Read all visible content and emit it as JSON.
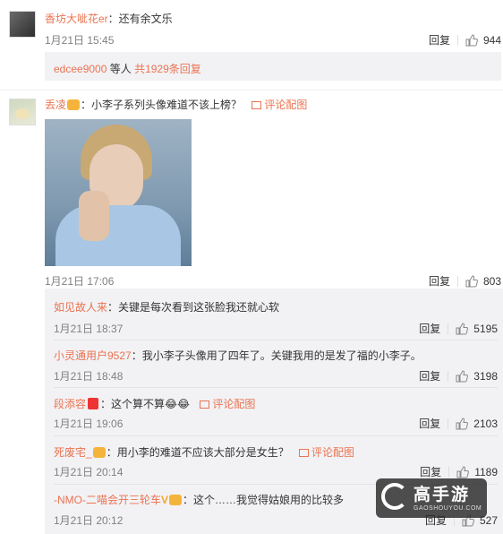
{
  "comments": [
    {
      "user": "香坊大呲花er",
      "text": "：还有余文乐",
      "time": "1月21日 15:45",
      "reply": "回复",
      "likes": "944"
    },
    {
      "user": "丢凌",
      "text": "：小李子系列头像难道不该上榜？",
      "pic_link": "评论配图",
      "time": "1月21日 17:06",
      "reply": "回复",
      "likes": "803"
    }
  ],
  "more_replies": {
    "user": "edcee9000",
    "middle": " 等人 ",
    "count": "共1929条回复"
  },
  "sub_replies": [
    {
      "user": "如见故人来",
      "text": "：关键是每次看到这张脸我还就心软",
      "time": "1月21日 18:37",
      "reply": "回复",
      "likes": "5195"
    },
    {
      "user": "小灵通用户9527",
      "text": "：我小李子头像用了四年了。关键我用的是发了福的小李子。",
      "time": "1月21日 18:48",
      "reply": "回复",
      "likes": "3198"
    },
    {
      "user": "段添容",
      "text": "：这个算不算",
      "emoji": "😂😂",
      "pic_link": "评论配图",
      "time": "1月21日 19:06",
      "reply": "回复",
      "likes": "2103"
    },
    {
      "user": "死废宅_",
      "text": "：用小李的难道不应该大部分是女生？",
      "pic_link": "评论配图",
      "time": "1月21日 20:14",
      "reply": "回复",
      "likes": "1189"
    },
    {
      "user": "-NMO-二喵会开三轮车",
      "text": "：这个……我觉得姑娘用的比较多",
      "time": "1月21日 20:12",
      "reply": "回复",
      "likes": "527"
    }
  ],
  "watermark": {
    "brand": "高手游",
    "url": "GAOSHOUYOU.COM"
  },
  "colors": {
    "username": "#eb7350",
    "timestamp": "#808080",
    "reply_bg": "#f2f2f5"
  }
}
